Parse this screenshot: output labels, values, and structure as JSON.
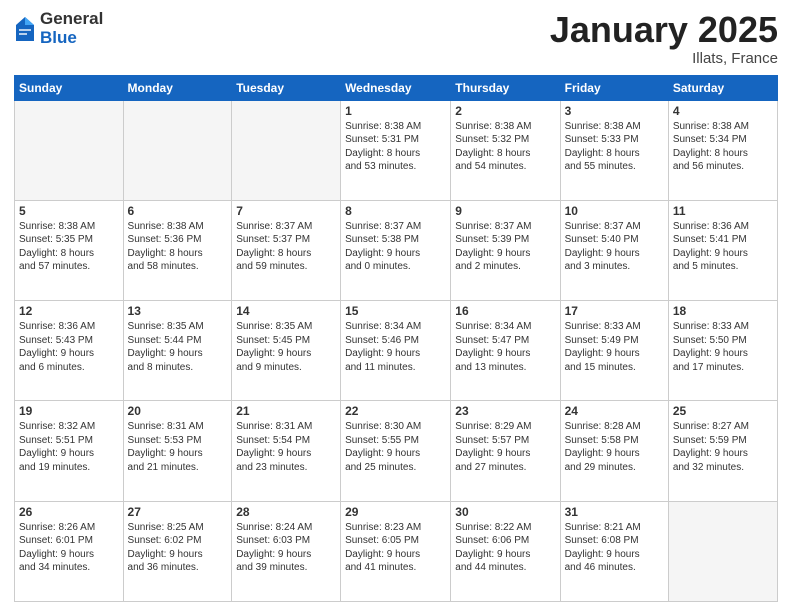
{
  "logo": {
    "general": "General",
    "blue": "Blue"
  },
  "header": {
    "month": "January 2025",
    "location": "Illats, France"
  },
  "days_of_week": [
    "Sunday",
    "Monday",
    "Tuesday",
    "Wednesday",
    "Thursday",
    "Friday",
    "Saturday"
  ],
  "weeks": [
    [
      {
        "day": "",
        "text": ""
      },
      {
        "day": "",
        "text": ""
      },
      {
        "day": "",
        "text": ""
      },
      {
        "day": "1",
        "text": "Sunrise: 8:38 AM\nSunset: 5:31 PM\nDaylight: 8 hours\nand 53 minutes."
      },
      {
        "day": "2",
        "text": "Sunrise: 8:38 AM\nSunset: 5:32 PM\nDaylight: 8 hours\nand 54 minutes."
      },
      {
        "day": "3",
        "text": "Sunrise: 8:38 AM\nSunset: 5:33 PM\nDaylight: 8 hours\nand 55 minutes."
      },
      {
        "day": "4",
        "text": "Sunrise: 8:38 AM\nSunset: 5:34 PM\nDaylight: 8 hours\nand 56 minutes."
      }
    ],
    [
      {
        "day": "5",
        "text": "Sunrise: 8:38 AM\nSunset: 5:35 PM\nDaylight: 8 hours\nand 57 minutes."
      },
      {
        "day": "6",
        "text": "Sunrise: 8:38 AM\nSunset: 5:36 PM\nDaylight: 8 hours\nand 58 minutes."
      },
      {
        "day": "7",
        "text": "Sunrise: 8:37 AM\nSunset: 5:37 PM\nDaylight: 8 hours\nand 59 minutes."
      },
      {
        "day": "8",
        "text": "Sunrise: 8:37 AM\nSunset: 5:38 PM\nDaylight: 9 hours\nand 0 minutes."
      },
      {
        "day": "9",
        "text": "Sunrise: 8:37 AM\nSunset: 5:39 PM\nDaylight: 9 hours\nand 2 minutes."
      },
      {
        "day": "10",
        "text": "Sunrise: 8:37 AM\nSunset: 5:40 PM\nDaylight: 9 hours\nand 3 minutes."
      },
      {
        "day": "11",
        "text": "Sunrise: 8:36 AM\nSunset: 5:41 PM\nDaylight: 9 hours\nand 5 minutes."
      }
    ],
    [
      {
        "day": "12",
        "text": "Sunrise: 8:36 AM\nSunset: 5:43 PM\nDaylight: 9 hours\nand 6 minutes."
      },
      {
        "day": "13",
        "text": "Sunrise: 8:35 AM\nSunset: 5:44 PM\nDaylight: 9 hours\nand 8 minutes."
      },
      {
        "day": "14",
        "text": "Sunrise: 8:35 AM\nSunset: 5:45 PM\nDaylight: 9 hours\nand 9 minutes."
      },
      {
        "day": "15",
        "text": "Sunrise: 8:34 AM\nSunset: 5:46 PM\nDaylight: 9 hours\nand 11 minutes."
      },
      {
        "day": "16",
        "text": "Sunrise: 8:34 AM\nSunset: 5:47 PM\nDaylight: 9 hours\nand 13 minutes."
      },
      {
        "day": "17",
        "text": "Sunrise: 8:33 AM\nSunset: 5:49 PM\nDaylight: 9 hours\nand 15 minutes."
      },
      {
        "day": "18",
        "text": "Sunrise: 8:33 AM\nSunset: 5:50 PM\nDaylight: 9 hours\nand 17 minutes."
      }
    ],
    [
      {
        "day": "19",
        "text": "Sunrise: 8:32 AM\nSunset: 5:51 PM\nDaylight: 9 hours\nand 19 minutes."
      },
      {
        "day": "20",
        "text": "Sunrise: 8:31 AM\nSunset: 5:53 PM\nDaylight: 9 hours\nand 21 minutes."
      },
      {
        "day": "21",
        "text": "Sunrise: 8:31 AM\nSunset: 5:54 PM\nDaylight: 9 hours\nand 23 minutes."
      },
      {
        "day": "22",
        "text": "Sunrise: 8:30 AM\nSunset: 5:55 PM\nDaylight: 9 hours\nand 25 minutes."
      },
      {
        "day": "23",
        "text": "Sunrise: 8:29 AM\nSunset: 5:57 PM\nDaylight: 9 hours\nand 27 minutes."
      },
      {
        "day": "24",
        "text": "Sunrise: 8:28 AM\nSunset: 5:58 PM\nDaylight: 9 hours\nand 29 minutes."
      },
      {
        "day": "25",
        "text": "Sunrise: 8:27 AM\nSunset: 5:59 PM\nDaylight: 9 hours\nand 32 minutes."
      }
    ],
    [
      {
        "day": "26",
        "text": "Sunrise: 8:26 AM\nSunset: 6:01 PM\nDaylight: 9 hours\nand 34 minutes."
      },
      {
        "day": "27",
        "text": "Sunrise: 8:25 AM\nSunset: 6:02 PM\nDaylight: 9 hours\nand 36 minutes."
      },
      {
        "day": "28",
        "text": "Sunrise: 8:24 AM\nSunset: 6:03 PM\nDaylight: 9 hours\nand 39 minutes."
      },
      {
        "day": "29",
        "text": "Sunrise: 8:23 AM\nSunset: 6:05 PM\nDaylight: 9 hours\nand 41 minutes."
      },
      {
        "day": "30",
        "text": "Sunrise: 8:22 AM\nSunset: 6:06 PM\nDaylight: 9 hours\nand 44 minutes."
      },
      {
        "day": "31",
        "text": "Sunrise: 8:21 AM\nSunset: 6:08 PM\nDaylight: 9 hours\nand 46 minutes."
      },
      {
        "day": "",
        "text": ""
      }
    ]
  ]
}
